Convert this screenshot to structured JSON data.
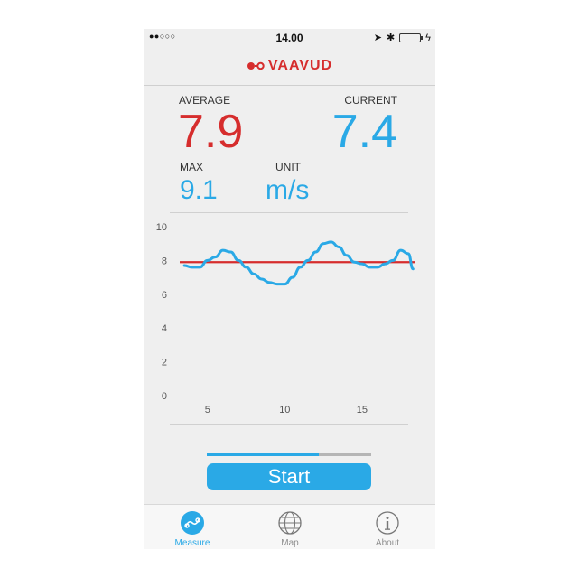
{
  "status_bar": {
    "signal": "●●○○○",
    "time": "14.00",
    "location_icon": "➤",
    "bluetooth_icon": "✱",
    "charging_icon": "ϟ"
  },
  "header": {
    "logo_text": "VAAVUD"
  },
  "readings": {
    "average_label": "AVERAGE",
    "average_value": "7.9",
    "current_label": "CURRENT",
    "current_value": "7.4",
    "max_label": "MAX",
    "max_value": "9.1",
    "unit_label": "UNIT",
    "unit_value": "m/s"
  },
  "colors": {
    "accent": "#2aa9e6",
    "average": "#d62d2d",
    "text": "#333333"
  },
  "chart_data": {
    "type": "line",
    "ylim": [
      0,
      10
    ],
    "xlim": [
      3.2,
      18.4
    ],
    "y_ticks": [
      0,
      2,
      4,
      6,
      8,
      10
    ],
    "x_ticks": [
      5,
      10,
      15
    ],
    "average_line": 7.9,
    "series": [
      {
        "x": [
          3.5,
          4.0,
          4.5,
          5.0,
          5.5,
          6.0,
          6.5,
          7.0,
          7.5,
          8.0,
          8.5,
          9.0,
          9.5,
          10.0,
          10.5,
          11.0,
          11.5,
          12.0,
          12.5,
          13.0,
          13.5,
          14.0,
          14.5,
          15.0,
          15.5,
          16.0,
          16.5,
          17.0,
          17.5,
          18.0,
          18.3
        ],
        "values": [
          7.7,
          7.6,
          7.6,
          8.0,
          8.2,
          8.6,
          8.5,
          8.0,
          7.6,
          7.2,
          6.9,
          6.7,
          6.6,
          6.6,
          7.0,
          7.6,
          8.0,
          8.5,
          9.0,
          9.1,
          8.8,
          8.3,
          7.9,
          7.8,
          7.6,
          7.6,
          7.8,
          8.0,
          8.6,
          8.4,
          7.5
        ]
      }
    ]
  },
  "progress": {
    "fraction": 0.68
  },
  "controls": {
    "start_label": "Start"
  },
  "tabs": [
    {
      "label": "Measure",
      "icon": "anemometer-icon",
      "active": true
    },
    {
      "label": "Map",
      "icon": "globe-icon",
      "active": false
    },
    {
      "label": "About",
      "icon": "info-icon",
      "active": false
    }
  ]
}
